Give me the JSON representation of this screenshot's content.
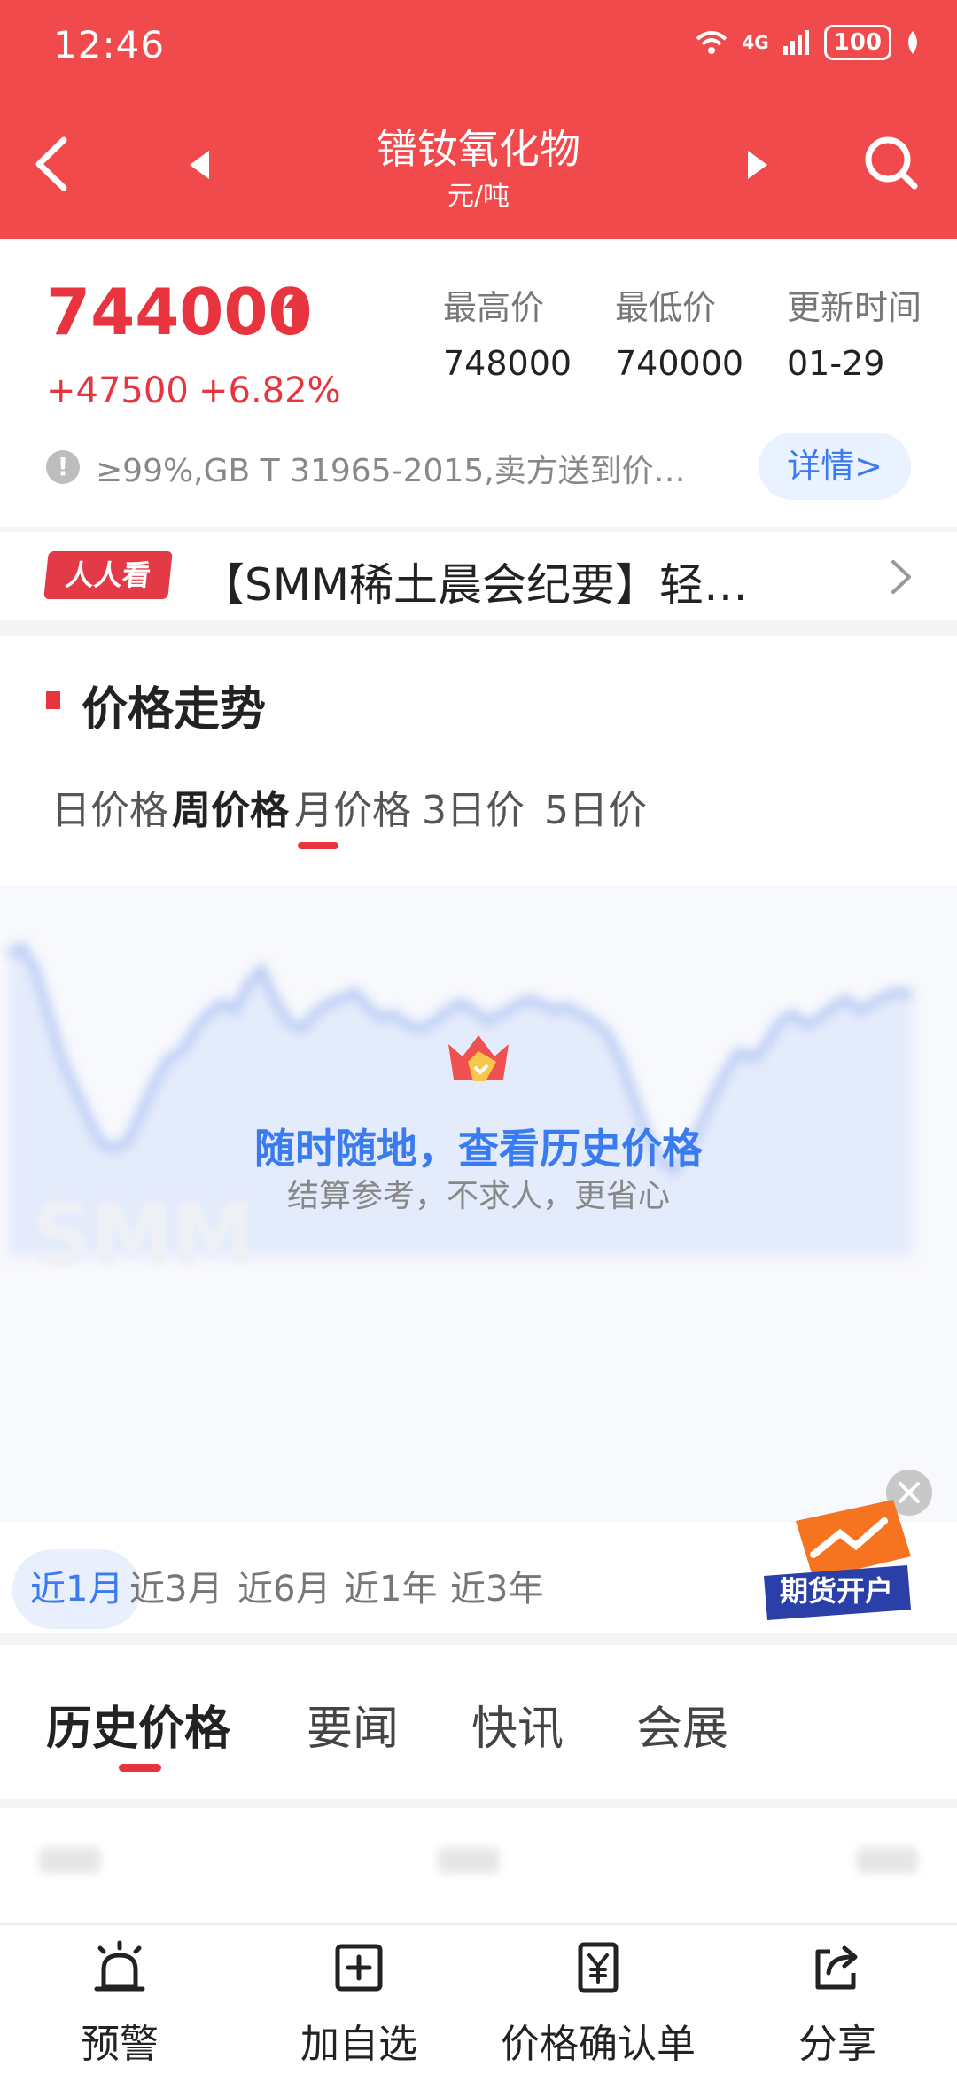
{
  "status_bar": {
    "time": "12:46",
    "network": "4G",
    "battery": "100"
  },
  "header": {
    "title": "镨钕氧化物",
    "subtitle": "元/吨"
  },
  "price": {
    "current": "744000",
    "change": "+47500",
    "change_pct": "+6.82%",
    "high_label": "最高价",
    "high_value": "748000",
    "low_label": "最低价",
    "low_value": "740000",
    "update_label": "更新时间",
    "update_value": "01-29",
    "spec": "≥99%,GB T 31965-2015,卖方送到价…",
    "detail_button": "详情>",
    "up_color": "#e8343e"
  },
  "news": {
    "badge": "人人看",
    "text": "【SMM稀土晨会纪要】轻…"
  },
  "trend": {
    "title": "价格走势",
    "period_tabs": [
      {
        "label": "日价格",
        "active": false
      },
      {
        "label": "周价格",
        "active": true
      },
      {
        "label": "月价格",
        "active": false
      },
      {
        "label": "3日价",
        "active": false
      },
      {
        "label": "5日价",
        "active": false
      }
    ],
    "overlay_title": "随时随地，查看历史价格",
    "overlay_sub": "结算参考，不求人，更省心",
    "watermark": "SMM",
    "range_tabs": [
      {
        "label": "近1月",
        "active": true
      },
      {
        "label": "近3月",
        "active": false
      },
      {
        "label": "近6月",
        "active": false
      },
      {
        "label": "近1年",
        "active": false
      },
      {
        "label": "近3年",
        "active": false
      }
    ],
    "promo_label": "期货开户"
  },
  "chart_data": {
    "type": "area",
    "title": "",
    "xlabel": "",
    "ylabel": "",
    "note": "blurred preview",
    "values": [
      86,
      88,
      82,
      70,
      58,
      50,
      42,
      35,
      34,
      36,
      44,
      52,
      58,
      60,
      66,
      70,
      73,
      71,
      78,
      82,
      74,
      68,
      66,
      70,
      73,
      74,
      76,
      72,
      69,
      70,
      67,
      66,
      68,
      71,
      73,
      71,
      68,
      70,
      72,
      74,
      73,
      71,
      72,
      70,
      68,
      65,
      58,
      48,
      38,
      31,
      28,
      33,
      40,
      48,
      55,
      60,
      58,
      62,
      68,
      70,
      67,
      69,
      72,
      74,
      71,
      73,
      75,
      76,
      75
    ]
  },
  "lower_tabs": [
    {
      "label": "历史价格",
      "active": true
    },
    {
      "label": "要闻",
      "active": false
    },
    {
      "label": "快讯",
      "active": false
    },
    {
      "label": "会展",
      "active": false
    }
  ],
  "bottom_nav": [
    {
      "label": "预警",
      "icon": "alarm-icon"
    },
    {
      "label": "加自选",
      "icon": "add-box-icon"
    },
    {
      "label": "价格确认单",
      "icon": "yuan-document-icon"
    },
    {
      "label": "分享",
      "icon": "share-icon"
    }
  ]
}
